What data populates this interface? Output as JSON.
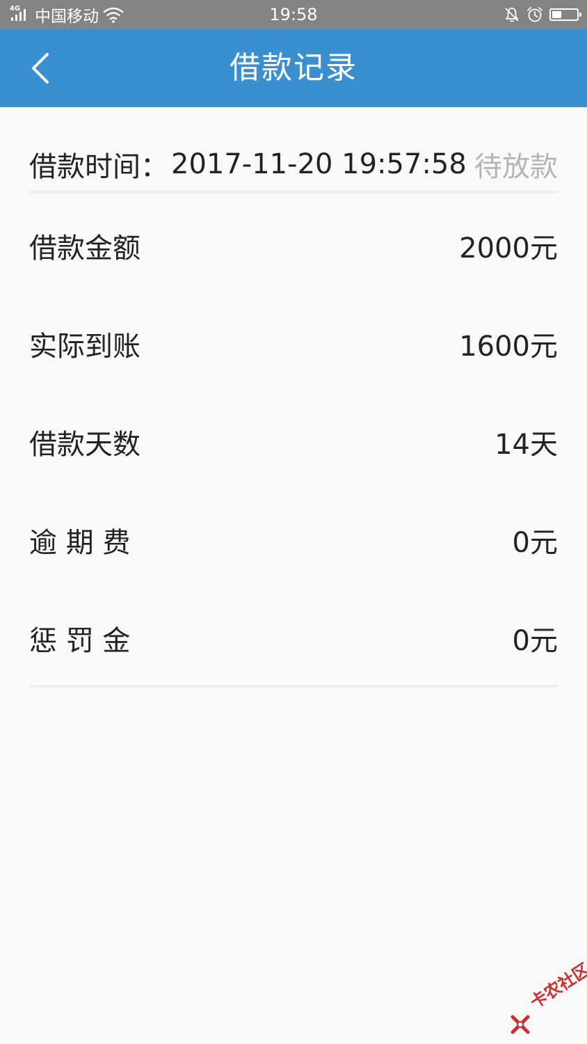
{
  "status_bar": {
    "network": "4G",
    "carrier": "中国移动",
    "time": "19:58",
    "battery_level": 0.44,
    "icons": [
      "signal-icon",
      "wifi-icon",
      "bell-muted-icon",
      "alarm-clock-icon",
      "battery-icon"
    ]
  },
  "header": {
    "title": "借款记录",
    "back_icon": "chevron-left-icon",
    "background": "#3a8fd1"
  },
  "loan": {
    "time_label": "借款时间：",
    "time_value": "2017-11-20 19:57:58",
    "status": "待放款",
    "status_color": "#b5b5b5"
  },
  "details": [
    {
      "label": "借款金额",
      "value": "2000元"
    },
    {
      "label": "实际到账",
      "value": "1600元"
    },
    {
      "label": "借款天数",
      "value": "14天"
    },
    {
      "label": "逾 期 费",
      "value": "0元"
    },
    {
      "label": "惩 罚 金",
      "value": "0元"
    }
  ],
  "watermark": {
    "text": "卡农社区",
    "color": "#d52b2b"
  }
}
